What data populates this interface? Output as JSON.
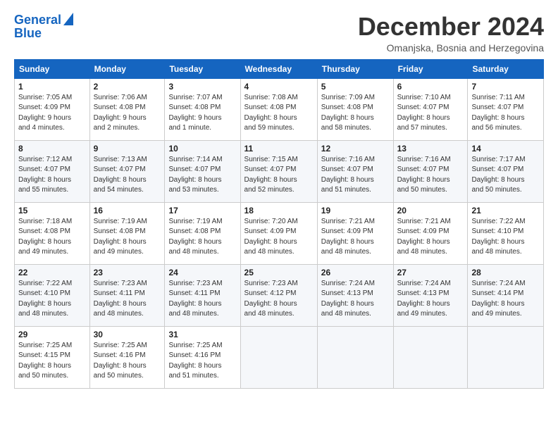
{
  "logo": {
    "line1": "General",
    "line2": "Blue"
  },
  "title": "December 2024",
  "subtitle": "Omanjska, Bosnia and Herzegovina",
  "days_header": [
    "Sunday",
    "Monday",
    "Tuesday",
    "Wednesday",
    "Thursday",
    "Friday",
    "Saturday"
  ],
  "weeks": [
    [
      {
        "day": "1",
        "info": "Sunrise: 7:05 AM\nSunset: 4:09 PM\nDaylight: 9 hours\nand 4 minutes."
      },
      {
        "day": "2",
        "info": "Sunrise: 7:06 AM\nSunset: 4:08 PM\nDaylight: 9 hours\nand 2 minutes."
      },
      {
        "day": "3",
        "info": "Sunrise: 7:07 AM\nSunset: 4:08 PM\nDaylight: 9 hours\nand 1 minute."
      },
      {
        "day": "4",
        "info": "Sunrise: 7:08 AM\nSunset: 4:08 PM\nDaylight: 8 hours\nand 59 minutes."
      },
      {
        "day": "5",
        "info": "Sunrise: 7:09 AM\nSunset: 4:08 PM\nDaylight: 8 hours\nand 58 minutes."
      },
      {
        "day": "6",
        "info": "Sunrise: 7:10 AM\nSunset: 4:07 PM\nDaylight: 8 hours\nand 57 minutes."
      },
      {
        "day": "7",
        "info": "Sunrise: 7:11 AM\nSunset: 4:07 PM\nDaylight: 8 hours\nand 56 minutes."
      }
    ],
    [
      {
        "day": "8",
        "info": "Sunrise: 7:12 AM\nSunset: 4:07 PM\nDaylight: 8 hours\nand 55 minutes."
      },
      {
        "day": "9",
        "info": "Sunrise: 7:13 AM\nSunset: 4:07 PM\nDaylight: 8 hours\nand 54 minutes."
      },
      {
        "day": "10",
        "info": "Sunrise: 7:14 AM\nSunset: 4:07 PM\nDaylight: 8 hours\nand 53 minutes."
      },
      {
        "day": "11",
        "info": "Sunrise: 7:15 AM\nSunset: 4:07 PM\nDaylight: 8 hours\nand 52 minutes."
      },
      {
        "day": "12",
        "info": "Sunrise: 7:16 AM\nSunset: 4:07 PM\nDaylight: 8 hours\nand 51 minutes."
      },
      {
        "day": "13",
        "info": "Sunrise: 7:16 AM\nSunset: 4:07 PM\nDaylight: 8 hours\nand 50 minutes."
      },
      {
        "day": "14",
        "info": "Sunrise: 7:17 AM\nSunset: 4:07 PM\nDaylight: 8 hours\nand 50 minutes."
      }
    ],
    [
      {
        "day": "15",
        "info": "Sunrise: 7:18 AM\nSunset: 4:08 PM\nDaylight: 8 hours\nand 49 minutes."
      },
      {
        "day": "16",
        "info": "Sunrise: 7:19 AM\nSunset: 4:08 PM\nDaylight: 8 hours\nand 49 minutes."
      },
      {
        "day": "17",
        "info": "Sunrise: 7:19 AM\nSunset: 4:08 PM\nDaylight: 8 hours\nand 48 minutes."
      },
      {
        "day": "18",
        "info": "Sunrise: 7:20 AM\nSunset: 4:09 PM\nDaylight: 8 hours\nand 48 minutes."
      },
      {
        "day": "19",
        "info": "Sunrise: 7:21 AM\nSunset: 4:09 PM\nDaylight: 8 hours\nand 48 minutes."
      },
      {
        "day": "20",
        "info": "Sunrise: 7:21 AM\nSunset: 4:09 PM\nDaylight: 8 hours\nand 48 minutes."
      },
      {
        "day": "21",
        "info": "Sunrise: 7:22 AM\nSunset: 4:10 PM\nDaylight: 8 hours\nand 48 minutes."
      }
    ],
    [
      {
        "day": "22",
        "info": "Sunrise: 7:22 AM\nSunset: 4:10 PM\nDaylight: 8 hours\nand 48 minutes."
      },
      {
        "day": "23",
        "info": "Sunrise: 7:23 AM\nSunset: 4:11 PM\nDaylight: 8 hours\nand 48 minutes."
      },
      {
        "day": "24",
        "info": "Sunrise: 7:23 AM\nSunset: 4:11 PM\nDaylight: 8 hours\nand 48 minutes."
      },
      {
        "day": "25",
        "info": "Sunrise: 7:23 AM\nSunset: 4:12 PM\nDaylight: 8 hours\nand 48 minutes."
      },
      {
        "day": "26",
        "info": "Sunrise: 7:24 AM\nSunset: 4:13 PM\nDaylight: 8 hours\nand 48 minutes."
      },
      {
        "day": "27",
        "info": "Sunrise: 7:24 AM\nSunset: 4:13 PM\nDaylight: 8 hours\nand 49 minutes."
      },
      {
        "day": "28",
        "info": "Sunrise: 7:24 AM\nSunset: 4:14 PM\nDaylight: 8 hours\nand 49 minutes."
      }
    ],
    [
      {
        "day": "29",
        "info": "Sunrise: 7:25 AM\nSunset: 4:15 PM\nDaylight: 8 hours\nand 50 minutes."
      },
      {
        "day": "30",
        "info": "Sunrise: 7:25 AM\nSunset: 4:16 PM\nDaylight: 8 hours\nand 50 minutes."
      },
      {
        "day": "31",
        "info": "Sunrise: 7:25 AM\nSunset: 4:16 PM\nDaylight: 8 hours\nand 51 minutes."
      },
      {
        "day": "",
        "info": ""
      },
      {
        "day": "",
        "info": ""
      },
      {
        "day": "",
        "info": ""
      },
      {
        "day": "",
        "info": ""
      }
    ]
  ]
}
